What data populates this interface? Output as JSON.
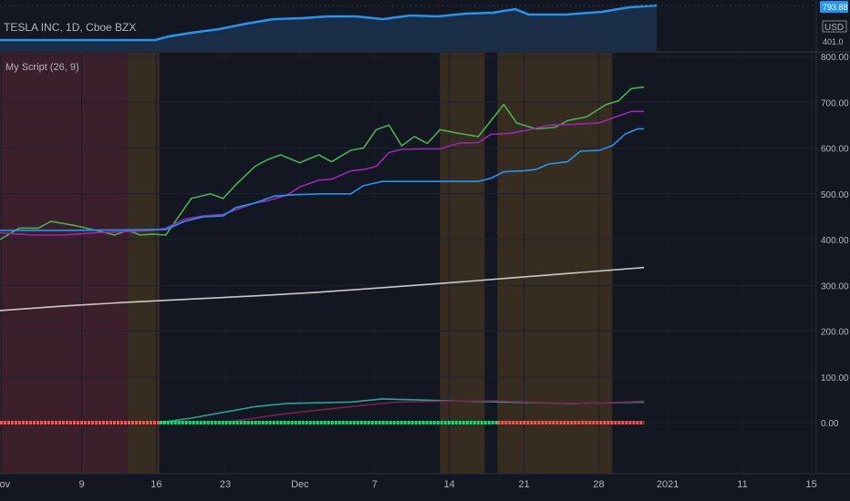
{
  "top_pane": {
    "symbol_label": "TESLA INC, 1D, Cboe BZX",
    "price_badge_top": "793.88",
    "currency_badge": "USD",
    "price_badge_bottom": "401.0",
    "line_color": "#2196f3"
  },
  "indicator": {
    "title": "My Script (26, 9)"
  },
  "colors": {
    "background": "#131722",
    "red_zone": "#3b1f2b",
    "orange_zone": "#372c20",
    "green_line": "#4caf50",
    "purple_line": "#9c27b0",
    "blue_line": "#2196f3",
    "gray_line": "#c8c8c8",
    "dots_red": "#ff5252",
    "dots_green": "#00e676"
  },
  "chart_data": {
    "type": "line",
    "x_ticks": [
      "Nov",
      "9",
      "16",
      "23",
      "Dec",
      "7",
      "14",
      "21",
      "28",
      "2021",
      "11",
      "15"
    ],
    "ylim": [
      -50,
      820
    ],
    "y_ticks": [
      "800.00",
      "700.00",
      "600.00",
      "500.00",
      "400.00",
      "300.00",
      "200.00",
      "100.00",
      "0.00"
    ],
    "background_zones": [
      {
        "color": "red",
        "from": 0,
        "to": 20
      },
      {
        "color": "orange",
        "from": 20,
        "to": 25
      },
      {
        "color": "orange",
        "from": 69,
        "to": 76
      },
      {
        "color": "orange",
        "from": 78,
        "to": 96
      }
    ],
    "series": [
      {
        "color": "green",
        "values": [
          [
            0,
            400
          ],
          [
            3,
            425
          ],
          [
            6,
            425
          ],
          [
            8,
            440
          ],
          [
            12,
            430
          ],
          [
            15,
            420
          ],
          [
            18,
            410
          ],
          [
            20,
            420
          ],
          [
            22,
            410
          ],
          [
            24,
            412
          ],
          [
            26,
            410
          ],
          [
            28,
            450
          ],
          [
            30,
            490
          ],
          [
            33,
            500
          ],
          [
            35,
            490
          ],
          [
            37,
            520
          ],
          [
            40,
            560
          ],
          [
            42,
            575
          ],
          [
            44,
            585
          ],
          [
            47,
            568
          ],
          [
            50,
            585
          ],
          [
            52,
            570
          ],
          [
            55,
            595
          ],
          [
            57,
            600
          ],
          [
            59,
            640
          ],
          [
            61,
            650
          ],
          [
            63,
            605
          ],
          [
            65,
            625
          ],
          [
            67,
            610
          ],
          [
            69,
            640
          ],
          [
            72,
            632
          ],
          [
            75,
            625
          ],
          [
            77,
            660
          ],
          [
            79,
            695
          ],
          [
            81,
            655
          ],
          [
            84,
            642
          ],
          [
            87,
            645
          ],
          [
            89,
            660
          ],
          [
            92,
            668
          ],
          [
            95,
            695
          ],
          [
            97,
            703
          ],
          [
            99,
            730
          ],
          [
            101,
            733
          ]
        ]
      },
      {
        "color": "purple",
        "values": [
          [
            0,
            415
          ],
          [
            5,
            410
          ],
          [
            10,
            410
          ],
          [
            15,
            415
          ],
          [
            24,
            420
          ],
          [
            26,
            425
          ],
          [
            29,
            445
          ],
          [
            32,
            452
          ],
          [
            35,
            455
          ],
          [
            37,
            465
          ],
          [
            40,
            480
          ],
          [
            42,
            485
          ],
          [
            45,
            497
          ],
          [
            47,
            515
          ],
          [
            50,
            530
          ],
          [
            52,
            532
          ],
          [
            55,
            550
          ],
          [
            57,
            553
          ],
          [
            59,
            560
          ],
          [
            61,
            590
          ],
          [
            63,
            597
          ],
          [
            66,
            598
          ],
          [
            69,
            598
          ],
          [
            72,
            611
          ],
          [
            75,
            612
          ],
          [
            77,
            630
          ],
          [
            80,
            632
          ],
          [
            83,
            640
          ],
          [
            86,
            650
          ],
          [
            90,
            652
          ],
          [
            94,
            655
          ],
          [
            97,
            670
          ],
          [
            99,
            680
          ],
          [
            101,
            680
          ]
        ]
      },
      {
        "color": "blue",
        "values": [
          [
            0,
            420
          ],
          [
            10,
            420
          ],
          [
            20,
            421
          ],
          [
            26,
            422
          ],
          [
            29,
            440
          ],
          [
            32,
            450
          ],
          [
            35,
            452
          ],
          [
            37,
            470
          ],
          [
            40,
            480
          ],
          [
            43,
            495
          ],
          [
            46,
            498
          ],
          [
            50,
            500
          ],
          [
            55,
            500
          ],
          [
            57,
            518
          ],
          [
            60,
            527
          ],
          [
            63,
            527
          ],
          [
            68,
            527
          ],
          [
            72,
            527
          ],
          [
            75,
            527
          ],
          [
            77,
            534
          ],
          [
            79,
            548
          ],
          [
            82,
            550
          ],
          [
            84,
            553
          ],
          [
            86,
            565
          ],
          [
            89,
            570
          ],
          [
            91,
            593
          ],
          [
            94,
            595
          ],
          [
            96,
            605
          ],
          [
            98,
            630
          ],
          [
            100,
            642
          ],
          [
            101,
            642
          ]
        ]
      },
      {
        "color": "gray",
        "values": [
          [
            0,
            245
          ],
          [
            10,
            255
          ],
          [
            20,
            263
          ],
          [
            30,
            270
          ],
          [
            40,
            277
          ],
          [
            50,
            285
          ],
          [
            60,
            295
          ],
          [
            70,
            305
          ],
          [
            80,
            316
          ],
          [
            90,
            327
          ],
          [
            101,
            339
          ]
        ]
      },
      {
        "color": "green-low",
        "values": [
          [
            25,
            0
          ],
          [
            30,
            10
          ],
          [
            40,
            35
          ],
          [
            45,
            42
          ],
          [
            55,
            45
          ],
          [
            60,
            52
          ],
          [
            70,
            48
          ],
          [
            80,
            45
          ],
          [
            90,
            42
          ],
          [
            101,
            45
          ]
        ]
      },
      {
        "color": "purple-low",
        "values": [
          [
            35,
            0
          ],
          [
            45,
            20
          ],
          [
            55,
            35
          ],
          [
            62,
            45
          ],
          [
            70,
            47
          ],
          [
            78,
            48
          ],
          [
            85,
            44
          ],
          [
            92,
            42
          ],
          [
            101,
            47
          ]
        ]
      }
    ],
    "dots": {
      "y_value": 0,
      "red_ranges": [
        [
          0,
          25
        ],
        [
          78,
          101
        ]
      ],
      "green_ranges": [
        [
          25,
          78
        ]
      ]
    }
  }
}
